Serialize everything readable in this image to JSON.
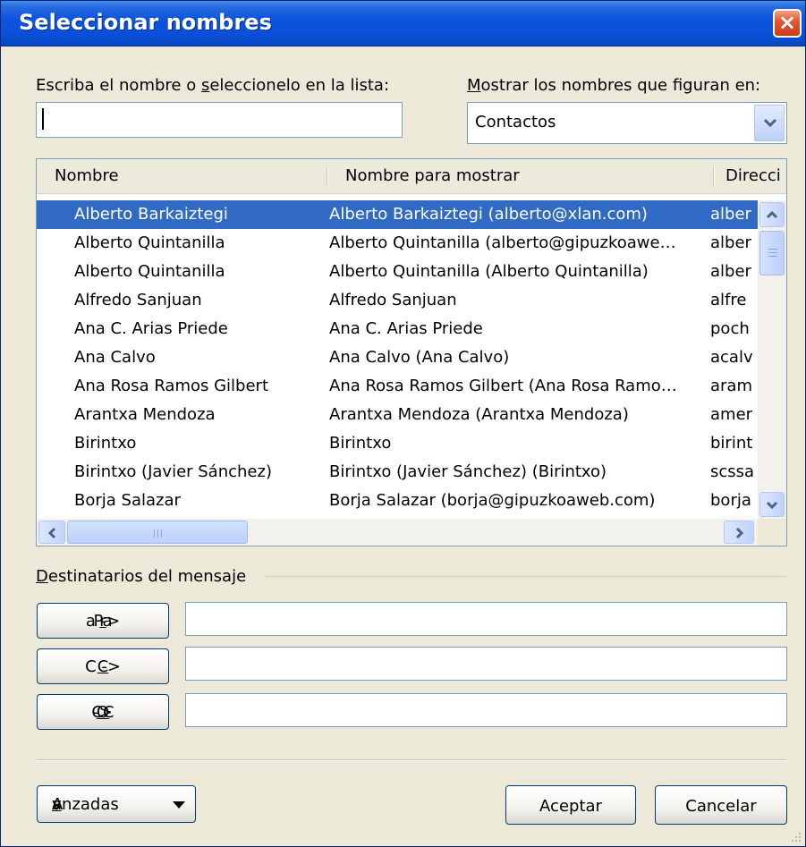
{
  "window": {
    "title": "Seleccionar nombres",
    "close": "×"
  },
  "search": {
    "label_pre": "Escriba el nombre o ",
    "label_key": "s",
    "label_post": "eleccionelo en la lista:",
    "value": ""
  },
  "addressbook": {
    "label_key": "M",
    "label_post": "ostrar los nombres que figuran en:",
    "selected": "Contactos"
  },
  "list": {
    "columns": [
      "Nombre",
      "Nombre para mostrar",
      "Direcci"
    ],
    "rows": [
      {
        "name": "Alberto Barkaiztegi",
        "display": "Alberto Barkaiztegi (alberto@xlan.com)",
        "email": "alber"
      },
      {
        "name": "Alberto Quintanilla",
        "display": "Alberto Quintanilla (alberto@gipuzkoawe…",
        "email": "alber"
      },
      {
        "name": "Alberto Quintanilla",
        "display": "Alberto Quintanilla (Alberto Quintanilla)",
        "email": "alber"
      },
      {
        "name": "Alfredo Sanjuan",
        "display": "Alfredo Sanjuan",
        "email": "alfre"
      },
      {
        "name": "Ana C. Arias Priede",
        "display": "Ana C. Arias Priede",
        "email": "poch"
      },
      {
        "name": "Ana Calvo",
        "display": "Ana Calvo (Ana Calvo)",
        "email": "acalv"
      },
      {
        "name": "Ana Rosa Ramos Gilbert",
        "display": "Ana Rosa Ramos Gilbert (Ana Rosa Ramo…",
        "email": "aram"
      },
      {
        "name": "Arantxa Mendoza",
        "display": "Arantxa Mendoza (Arantxa Mendoza)",
        "email": "amer"
      },
      {
        "name": "Birintxo",
        "display": "Birintxo",
        "email": "birint"
      },
      {
        "name": "Birintxo (Javier Sánchez)",
        "display": "Birintxo (Javier Sánchez) (Birintxo)",
        "email": "scssa"
      },
      {
        "name": "Borja Salazar",
        "display": "Borja Salazar (borja@gipuzkoaweb.com)",
        "email": "borja"
      }
    ]
  },
  "recipients": {
    "label_key": "D",
    "label_post": "estinatarios del mensaje",
    "to_pre": "Pa",
    "to_key": "r",
    "to_post": "a ->",
    "to_value": "",
    "cc_key": "C",
    "cc_post": "C ->",
    "cc_value": "",
    "bcc_pre": "CC",
    "bcc_key": "O",
    "bcc_post": " ->",
    "bcc_value": ""
  },
  "footer": {
    "advanced_pre": "A",
    "advanced_key": "v",
    "advanced_post": "anzadas",
    "ok": "Aceptar",
    "cancel": "Cancelar"
  },
  "colors": {
    "title_bar": "#0a4fd8",
    "selection": "#316ac5",
    "dialog_bg": "#ece9d8"
  }
}
